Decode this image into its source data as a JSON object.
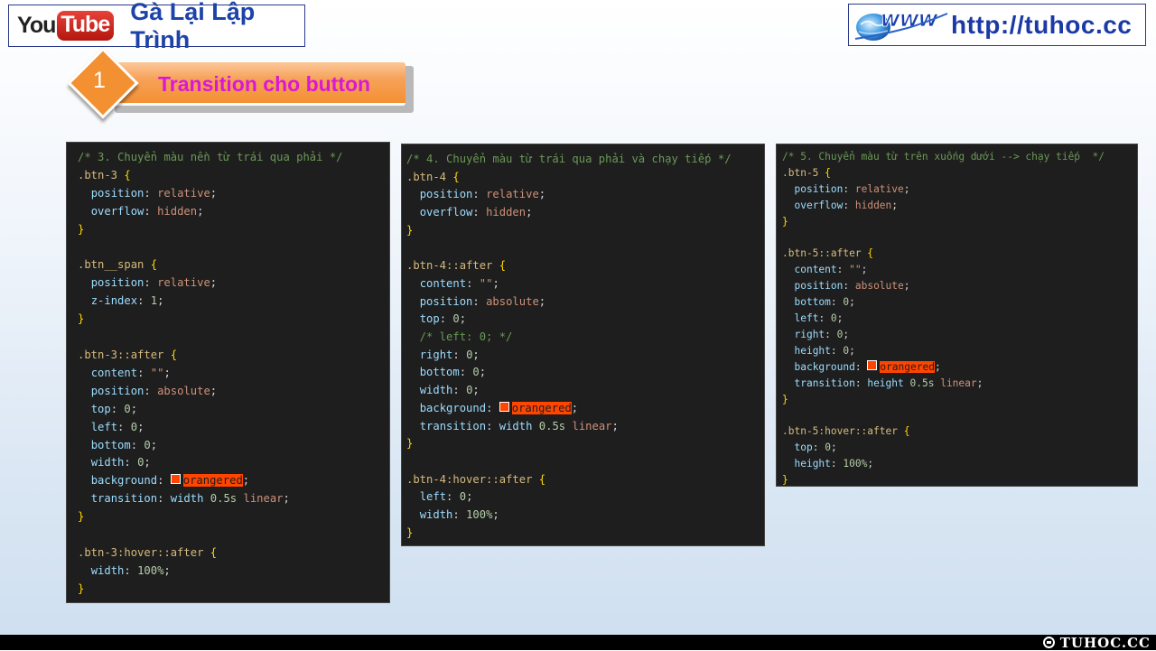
{
  "header": {
    "youtube_you": "You",
    "youtube_tube": "Tube",
    "channel_name": "Gà Lại Lập Trình",
    "site_url": "http://tuhoc.cc"
  },
  "section": {
    "number": "1",
    "title": "Transition cho button"
  },
  "colors": {
    "section_title": "#d917d9",
    "section_bar": "#f39032",
    "code_background": "#1e1e1e",
    "highlight": "#ff4500"
  },
  "watermark": "TUHOC.CC",
  "panels": [
    {
      "name": "btn-3",
      "lines": [
        {
          "t": "/* 3. Chuyển màu nền từ trái qua phải */",
          "k": "comment"
        },
        {
          "t": ".btn-3 {",
          "k": "selector"
        },
        {
          "t": "  position: relative;",
          "k": "decl"
        },
        {
          "t": "  overflow: hidden;",
          "k": "decl"
        },
        {
          "t": "}",
          "k": "brace"
        },
        {
          "t": "",
          "k": "blank"
        },
        {
          "t": ".btn__span {",
          "k": "selector"
        },
        {
          "t": "  position: relative;",
          "k": "decl"
        },
        {
          "t": "  z-index: 1;",
          "k": "decl"
        },
        {
          "t": "}",
          "k": "brace"
        },
        {
          "t": "",
          "k": "blank"
        },
        {
          "t": ".btn-3::after {",
          "k": "selector"
        },
        {
          "t": "  content: \"\";",
          "k": "decl"
        },
        {
          "t": "  position: absolute;",
          "k": "decl"
        },
        {
          "t": "  top: 0;",
          "k": "decl"
        },
        {
          "t": "  left: 0;",
          "k": "decl"
        },
        {
          "t": "  bottom: 0;",
          "k": "decl"
        },
        {
          "t": "  width: 0;",
          "k": "decl"
        },
        {
          "t": "  background: orangered;",
          "k": "color"
        },
        {
          "t": "  transition: width 0.5s linear;",
          "k": "decl"
        },
        {
          "t": "}",
          "k": "brace"
        },
        {
          "t": "",
          "k": "blank"
        },
        {
          "t": ".btn-3:hover::after {",
          "k": "selector"
        },
        {
          "t": "  width: 100%;",
          "k": "decl"
        },
        {
          "t": "}",
          "k": "brace"
        }
      ]
    },
    {
      "name": "btn-4",
      "lines": [
        {
          "t": "/* 4. Chuyển màu từ trái qua phải và chạy tiếp */",
          "k": "comment"
        },
        {
          "t": ".btn-4 {",
          "k": "selector"
        },
        {
          "t": "  position: relative;",
          "k": "decl"
        },
        {
          "t": "  overflow: hidden;",
          "k": "decl"
        },
        {
          "t": "}",
          "k": "brace"
        },
        {
          "t": "",
          "k": "blank"
        },
        {
          "t": ".btn-4::after {",
          "k": "selector"
        },
        {
          "t": "  content: \"\";",
          "k": "decl"
        },
        {
          "t": "  position: absolute;",
          "k": "decl"
        },
        {
          "t": "  top: 0;",
          "k": "decl"
        },
        {
          "t": "  /* left: 0; */",
          "k": "comment"
        },
        {
          "t": "  right: 0;",
          "k": "decl"
        },
        {
          "t": "  bottom: 0;",
          "k": "decl"
        },
        {
          "t": "  width: 0;",
          "k": "decl"
        },
        {
          "t": "  background: orangered;",
          "k": "color"
        },
        {
          "t": "  transition: width 0.5s linear;",
          "k": "decl"
        },
        {
          "t": "}",
          "k": "brace"
        },
        {
          "t": "",
          "k": "blank"
        },
        {
          "t": ".btn-4:hover::after {",
          "k": "selector"
        },
        {
          "t": "  left: 0;",
          "k": "decl"
        },
        {
          "t": "  width: 100%;",
          "k": "decl"
        },
        {
          "t": "}",
          "k": "brace"
        }
      ]
    },
    {
      "name": "btn-5",
      "lines": [
        {
          "t": "/* 5. Chuyển màu từ trên xuống dưới --> chạy tiếp  */",
          "k": "comment"
        },
        {
          "t": ".btn-5 {",
          "k": "selector"
        },
        {
          "t": "  position: relative;",
          "k": "decl"
        },
        {
          "t": "  overflow: hidden;",
          "k": "decl"
        },
        {
          "t": "}",
          "k": "brace"
        },
        {
          "t": "",
          "k": "blank"
        },
        {
          "t": ".btn-5::after {",
          "k": "selector"
        },
        {
          "t": "  content: \"\";",
          "k": "decl"
        },
        {
          "t": "  position: absolute;",
          "k": "decl"
        },
        {
          "t": "  bottom: 0;",
          "k": "decl"
        },
        {
          "t": "  left: 0;",
          "k": "decl"
        },
        {
          "t": "  right: 0;",
          "k": "decl"
        },
        {
          "t": "  height: 0;",
          "k": "decl"
        },
        {
          "t": "  background: orangered;",
          "k": "color"
        },
        {
          "t": "  transition: height 0.5s linear;",
          "k": "decl"
        },
        {
          "t": "}",
          "k": "brace"
        },
        {
          "t": "",
          "k": "blank"
        },
        {
          "t": ".btn-5:hover::after {",
          "k": "selector"
        },
        {
          "t": "  top: 0;",
          "k": "decl"
        },
        {
          "t": "  height: 100%;",
          "k": "decl"
        },
        {
          "t": "}",
          "k": "brace"
        }
      ]
    }
  ]
}
